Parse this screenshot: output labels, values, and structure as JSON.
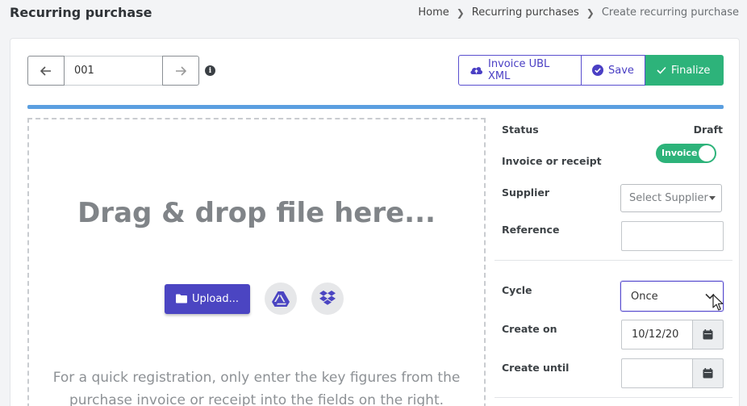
{
  "header": {
    "title": "Recurring purchase",
    "breadcrumb": [
      "Home",
      "Recurring purchases",
      "Create recurring purchase"
    ]
  },
  "pager": {
    "number": "001"
  },
  "actions": {
    "ubl_label": "Invoice UBL XML",
    "save_label": "Save",
    "finalize_label": "Finalize"
  },
  "progress": {
    "percent": 100
  },
  "dropzone": {
    "title": "Drag & drop file here...",
    "upload_label": "Upload...",
    "hint_line1": "For a quick registration, only enter the key figures from the",
    "hint_line2": "purchase invoice or receipt into the fields on the right."
  },
  "form": {
    "status_label": "Status",
    "status_value": "Draft",
    "type_label": "Invoice or receipt",
    "type_toggle": "Invoice",
    "supplier_label": "Supplier",
    "supplier_placeholder": "Select Supplier",
    "reference_label": "Reference",
    "cycle_label": "Cycle",
    "cycle_value": "Once",
    "create_on_label": "Create on",
    "create_on_value": "10/12/20",
    "create_until_label": "Create until",
    "create_until_value": ""
  },
  "colors": {
    "accent": "#4b45c2",
    "success": "#2db37a",
    "progress": "#5b9fe0"
  }
}
